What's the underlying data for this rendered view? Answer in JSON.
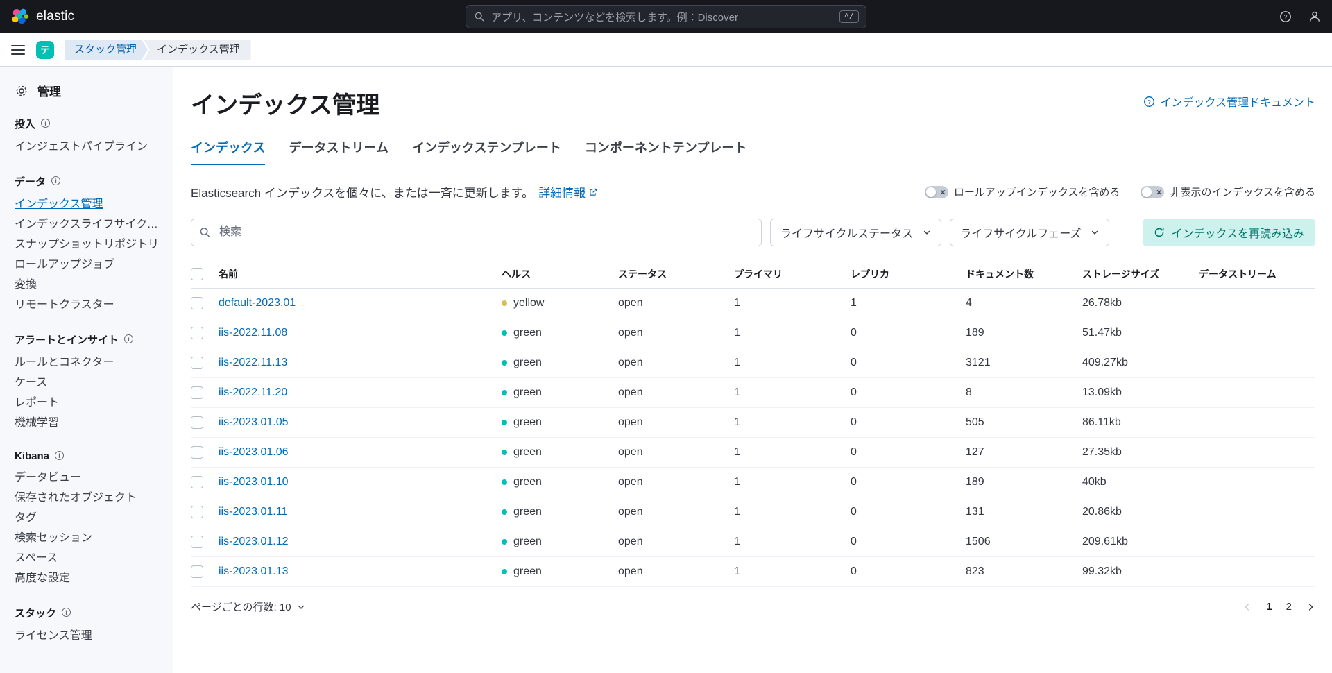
{
  "colors": {
    "accent_teal": "#00BFB3",
    "primary_blue": "#006BB8",
    "health_green": "#00BFB3",
    "health_yellow": "#D6BF57",
    "reload_button_bg": "#CDF1ED",
    "top_bar_bg": "#17181E"
  },
  "header": {
    "brand": "elastic",
    "search_placeholder": "アプリ、コンテンツなどを検索します。例：Discover",
    "shortcut_hint": "^/"
  },
  "nav_bar": {
    "space_badge": "テ",
    "breadcrumbs": [
      {
        "label": "スタック管理"
      },
      {
        "label": "インデックス管理"
      }
    ]
  },
  "sidebar": {
    "title": "管理",
    "sections": [
      {
        "label": "投入",
        "items": [
          {
            "label": "インジェストパイプライン",
            "state": ""
          }
        ]
      },
      {
        "label": "データ",
        "items": [
          {
            "label": "インデックス管理",
            "state": "active"
          },
          {
            "label": "インデックスライフサイクル...",
            "state": ""
          },
          {
            "label": "スナップショットリポジトリ",
            "state": ""
          },
          {
            "label": "ロールアップジョブ",
            "state": ""
          },
          {
            "label": "変換",
            "state": ""
          },
          {
            "label": "リモートクラスター",
            "state": ""
          }
        ]
      },
      {
        "label": "アラートとインサイト",
        "items": [
          {
            "label": "ルールとコネクター",
            "state": ""
          },
          {
            "label": "ケース",
            "state": ""
          },
          {
            "label": "レポート",
            "state": ""
          },
          {
            "label": "機械学習",
            "state": ""
          }
        ]
      },
      {
        "label": "Kibana",
        "items": [
          {
            "label": "データビュー",
            "state": ""
          },
          {
            "label": "保存されたオブジェクト",
            "state": ""
          },
          {
            "label": "タグ",
            "state": ""
          },
          {
            "label": "検索セッション",
            "state": ""
          },
          {
            "label": "スペース",
            "state": ""
          },
          {
            "label": "高度な設定",
            "state": ""
          }
        ]
      },
      {
        "label": "スタック",
        "items": [
          {
            "label": "ライセンス管理",
            "state": ""
          }
        ]
      }
    ]
  },
  "main": {
    "title": "インデックス管理",
    "doc_link_label": "インデックス管理ドキュメント",
    "tabs": [
      {
        "label": "インデックス",
        "state": "active"
      },
      {
        "label": "データストリーム",
        "state": ""
      },
      {
        "label": "インデックステンプレート",
        "state": ""
      },
      {
        "label": "コンポーネントテンプレート",
        "state": ""
      }
    ],
    "description": "Elasticsearch インデックスを個々に、または一斉に更新します。",
    "details_link_label": "詳細情報",
    "toggles": [
      {
        "label": "ロールアップインデックスを含める"
      },
      {
        "label": "非表示のインデックスを含める"
      }
    ],
    "search_placeholder": "検索",
    "filters": [
      {
        "label": "ライフサイクルステータス"
      },
      {
        "label": "ライフサイクルフェーズ"
      }
    ],
    "reload_button_label": "インデックスを再読み込み",
    "table": {
      "columns": [
        {
          "label": "名前"
        },
        {
          "label": "ヘルス"
        },
        {
          "label": "ステータス"
        },
        {
          "label": "プライマリ"
        },
        {
          "label": "レプリカ"
        },
        {
          "label": "ドキュメント数"
        },
        {
          "label": "ストレージサイズ"
        },
        {
          "label": "データストリーム"
        }
      ],
      "rows": [
        {
          "name": "default-2023.01",
          "health": "yellow",
          "status": "open",
          "primary": "1",
          "replica": "1",
          "docs": "4",
          "storage": "26.78kb",
          "datastream": ""
        },
        {
          "name": "iis-2022.11.08",
          "health": "green",
          "status": "open",
          "primary": "1",
          "replica": "0",
          "docs": "189",
          "storage": "51.47kb",
          "datastream": ""
        },
        {
          "name": "iis-2022.11.13",
          "health": "green",
          "status": "open",
          "primary": "1",
          "replica": "0",
          "docs": "3121",
          "storage": "409.27kb",
          "datastream": ""
        },
        {
          "name": "iis-2022.11.20",
          "health": "green",
          "status": "open",
          "primary": "1",
          "replica": "0",
          "docs": "8",
          "storage": "13.09kb",
          "datastream": ""
        },
        {
          "name": "iis-2023.01.05",
          "health": "green",
          "status": "open",
          "primary": "1",
          "replica": "0",
          "docs": "505",
          "storage": "86.11kb",
          "datastream": ""
        },
        {
          "name": "iis-2023.01.06",
          "health": "green",
          "status": "open",
          "primary": "1",
          "replica": "0",
          "docs": "127",
          "storage": "27.35kb",
          "datastream": ""
        },
        {
          "name": "iis-2023.01.10",
          "health": "green",
          "status": "open",
          "primary": "1",
          "replica": "0",
          "docs": "189",
          "storage": "40kb",
          "datastream": ""
        },
        {
          "name": "iis-2023.01.11",
          "health": "green",
          "status": "open",
          "primary": "1",
          "replica": "0",
          "docs": "131",
          "storage": "20.86kb",
          "datastream": ""
        },
        {
          "name": "iis-2023.01.12",
          "health": "green",
          "status": "open",
          "primary": "1",
          "replica": "0",
          "docs": "1506",
          "storage": "209.61kb",
          "datastream": ""
        },
        {
          "name": "iis-2023.01.13",
          "health": "green",
          "status": "open",
          "primary": "1",
          "replica": "0",
          "docs": "823",
          "storage": "99.32kb",
          "datastream": ""
        }
      ]
    },
    "footer": {
      "rows_per_page_label": "ページごとの行数: 10",
      "pages": [
        {
          "label": "1",
          "state": "active"
        },
        {
          "label": "2",
          "state": ""
        }
      ]
    }
  }
}
